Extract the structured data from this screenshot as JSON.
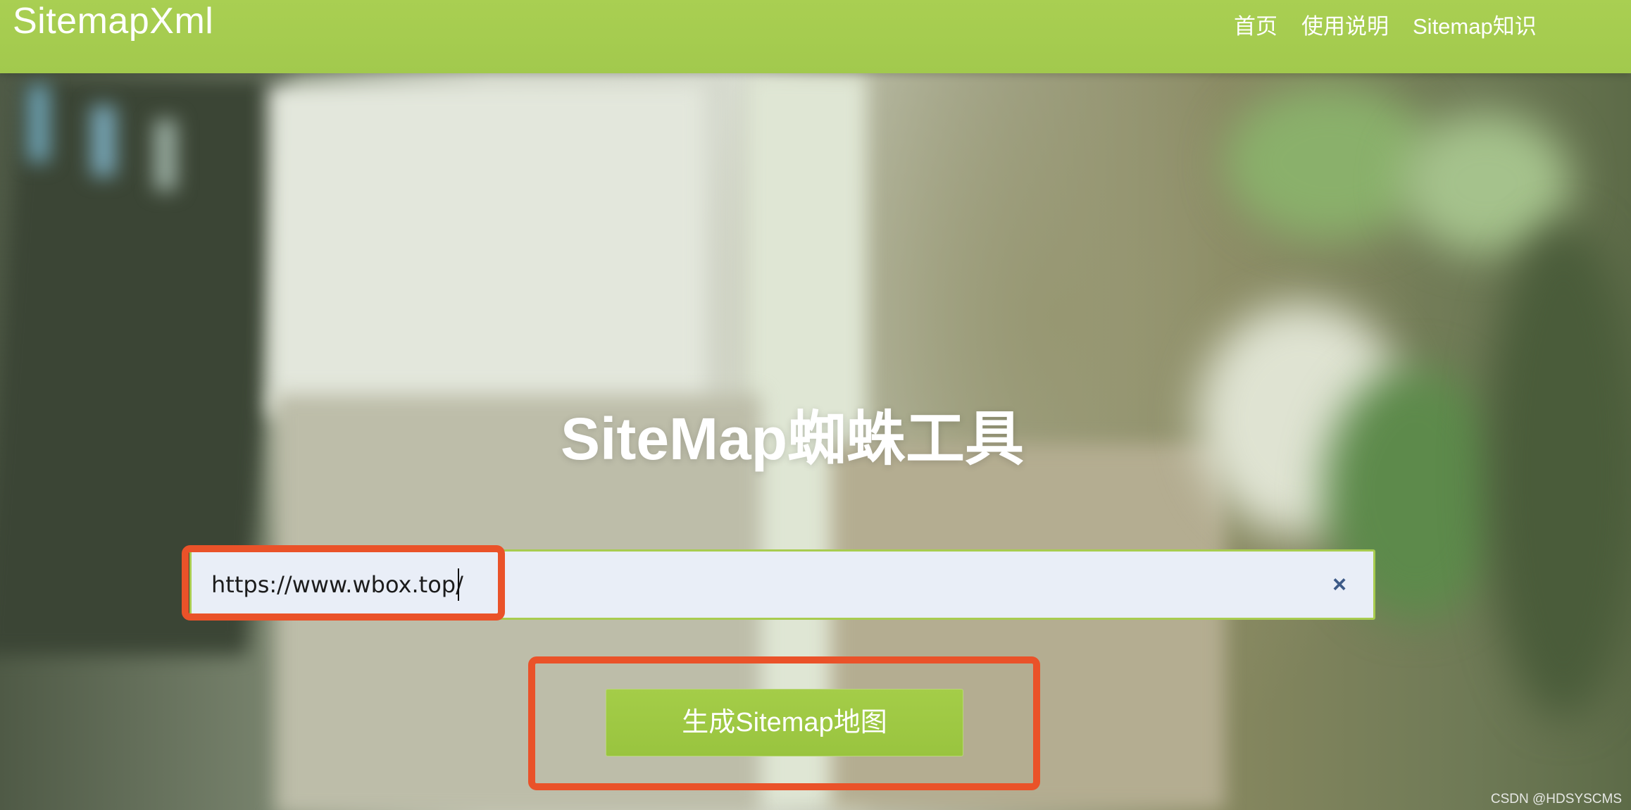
{
  "header": {
    "brand": "SitemapXml",
    "nav": [
      {
        "label": "首页"
      },
      {
        "label": "使用说明"
      },
      {
        "label": "Sitemap知识"
      }
    ]
  },
  "hero": {
    "title": "SiteMap蜘蛛工具",
    "url_input": {
      "value": "https://www.wbox.top/"
    },
    "clear_icon": "×",
    "generate_button": "生成Sitemap地图"
  },
  "watermark": "CSDN @HDSYSCMS",
  "colors": {
    "header_green": "#a9cf52",
    "button_green": "#a4cd48",
    "annotation_red": "#ea5229",
    "input_bg": "#e9eef7",
    "clear_icon": "#3d5a87"
  }
}
